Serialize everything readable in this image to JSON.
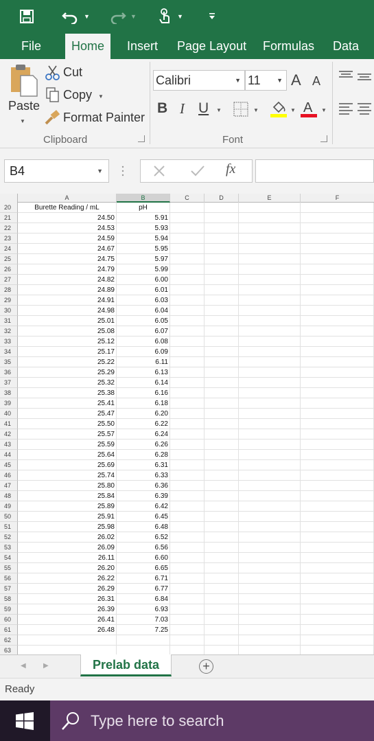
{
  "tabs": [
    "File",
    "Home",
    "Insert",
    "Page Layout",
    "Formulas",
    "Data"
  ],
  "active_tab": "Home",
  "clipboard": {
    "paste": "Paste",
    "cut": "Cut",
    "copy": "Copy",
    "format_painter": "Format Painter",
    "group_label": "Clipboard"
  },
  "font": {
    "family": "Calibri",
    "size": "11",
    "group_label": "Font",
    "bold": "B",
    "italic": "I",
    "underline": "U",
    "grow": "A",
    "shrink": "A",
    "fill_color": "#ffff00",
    "font_color": "#e81123"
  },
  "formula_bar": {
    "name_box": "B4",
    "fx": "fx",
    "value": ""
  },
  "columns": [
    "A",
    "B",
    "C",
    "D",
    "E",
    "F"
  ],
  "selected_column": "B",
  "header_row": {
    "row": "20",
    "a": "Burette Reading / mL",
    "b": "pH"
  },
  "data_rows": [
    {
      "row": "21",
      "a": "24.50",
      "b": "5.91"
    },
    {
      "row": "22",
      "a": "24.53",
      "b": "5.93"
    },
    {
      "row": "23",
      "a": "24.59",
      "b": "5.94"
    },
    {
      "row": "24",
      "a": "24.67",
      "b": "5.95"
    },
    {
      "row": "25",
      "a": "24.75",
      "b": "5.97"
    },
    {
      "row": "26",
      "a": "24.79",
      "b": "5.99"
    },
    {
      "row": "27",
      "a": "24.82",
      "b": "6.00"
    },
    {
      "row": "28",
      "a": "24.89",
      "b": "6.01"
    },
    {
      "row": "29",
      "a": "24.91",
      "b": "6.03"
    },
    {
      "row": "30",
      "a": "24.98",
      "b": "6.04"
    },
    {
      "row": "31",
      "a": "25.01",
      "b": "6.05"
    },
    {
      "row": "32",
      "a": "25.08",
      "b": "6.07"
    },
    {
      "row": "33",
      "a": "25.12",
      "b": "6.08"
    },
    {
      "row": "34",
      "a": "25.17",
      "b": "6.09"
    },
    {
      "row": "35",
      "a": "25.22",
      "b": "6.11"
    },
    {
      "row": "36",
      "a": "25.29",
      "b": "6.13"
    },
    {
      "row": "37",
      "a": "25.32",
      "b": "6.14"
    },
    {
      "row": "38",
      "a": "25.38",
      "b": "6.16"
    },
    {
      "row": "39",
      "a": "25.41",
      "b": "6.18"
    },
    {
      "row": "40",
      "a": "25.47",
      "b": "6.20"
    },
    {
      "row": "41",
      "a": "25.50",
      "b": "6.22"
    },
    {
      "row": "42",
      "a": "25.57",
      "b": "6.24"
    },
    {
      "row": "43",
      "a": "25.59",
      "b": "6.26"
    },
    {
      "row": "44",
      "a": "25.64",
      "b": "6.28"
    },
    {
      "row": "45",
      "a": "25.69",
      "b": "6.31"
    },
    {
      "row": "46",
      "a": "25.74",
      "b": "6.33"
    },
    {
      "row": "47",
      "a": "25.80",
      "b": "6.36"
    },
    {
      "row": "48",
      "a": "25.84",
      "b": "6.39"
    },
    {
      "row": "49",
      "a": "25.89",
      "b": "6.42"
    },
    {
      "row": "50",
      "a": "25.91",
      "b": "6.45"
    },
    {
      "row": "51",
      "a": "25.98",
      "b": "6.48"
    },
    {
      "row": "52",
      "a": "26.02",
      "b": "6.52"
    },
    {
      "row": "53",
      "a": "26.09",
      "b": "6.56"
    },
    {
      "row": "54",
      "a": "26.11",
      "b": "6.60"
    },
    {
      "row": "55",
      "a": "26.20",
      "b": "6.65"
    },
    {
      "row": "56",
      "a": "26.22",
      "b": "6.71"
    },
    {
      "row": "57",
      "a": "26.29",
      "b": "6.77"
    },
    {
      "row": "58",
      "a": "26.31",
      "b": "6.84"
    },
    {
      "row": "59",
      "a": "26.39",
      "b": "6.93"
    },
    {
      "row": "60",
      "a": "26.41",
      "b": "7.03"
    },
    {
      "row": "61",
      "a": "26.48",
      "b": "7.25"
    },
    {
      "row": "62",
      "a": "",
      "b": ""
    },
    {
      "row": "63",
      "a": "",
      "b": ""
    }
  ],
  "sheet_tab": "Prelab data",
  "add_sheet": "+",
  "status": "Ready",
  "taskbar": {
    "search_placeholder": "Type here to search"
  },
  "accent_color": "#217346"
}
